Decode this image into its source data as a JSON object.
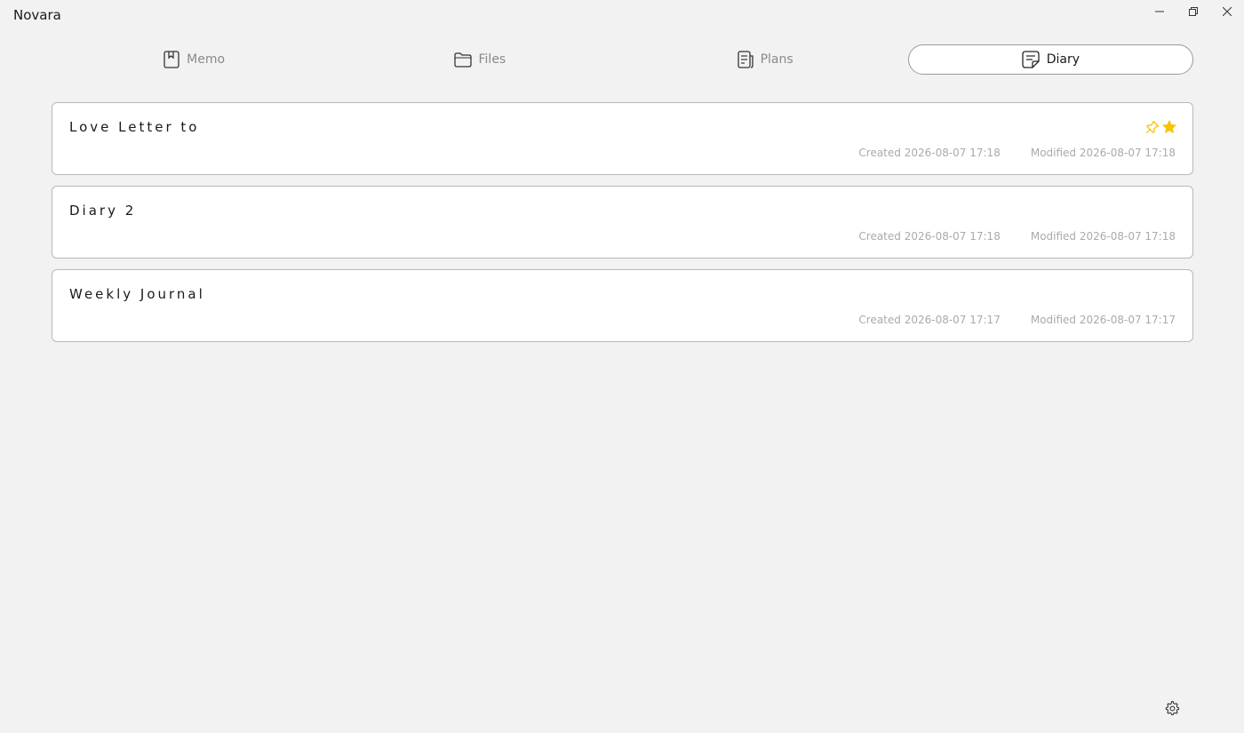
{
  "app": {
    "title": "Novara"
  },
  "tabs": [
    {
      "label": "Memo",
      "icon": "memo-icon",
      "active": false
    },
    {
      "label": "Files",
      "icon": "folder-icon",
      "active": false
    },
    {
      "label": "Plans",
      "icon": "plans-icon",
      "active": false
    },
    {
      "label": "Diary",
      "icon": "diary-icon",
      "active": true
    }
  ],
  "entries": [
    {
      "title": "Love Letter to",
      "created": "Created 2026-08-07 17:18",
      "modified": "Modified 2026-08-07 17:18",
      "pinned": true,
      "starred": true
    },
    {
      "title": "Diary 2",
      "created": "Created 2026-08-07 17:18",
      "modified": "Modified 2026-08-07 17:18",
      "pinned": false,
      "starred": false
    },
    {
      "title": "Weekly Journal",
      "created": "Created 2026-08-07 17:17",
      "modified": "Modified 2026-08-07 17:17",
      "pinned": false,
      "starred": false
    }
  ],
  "colors": {
    "accent": "#f5c400",
    "background": "#f2f2f2",
    "meta_text": "#aaaaaa"
  }
}
